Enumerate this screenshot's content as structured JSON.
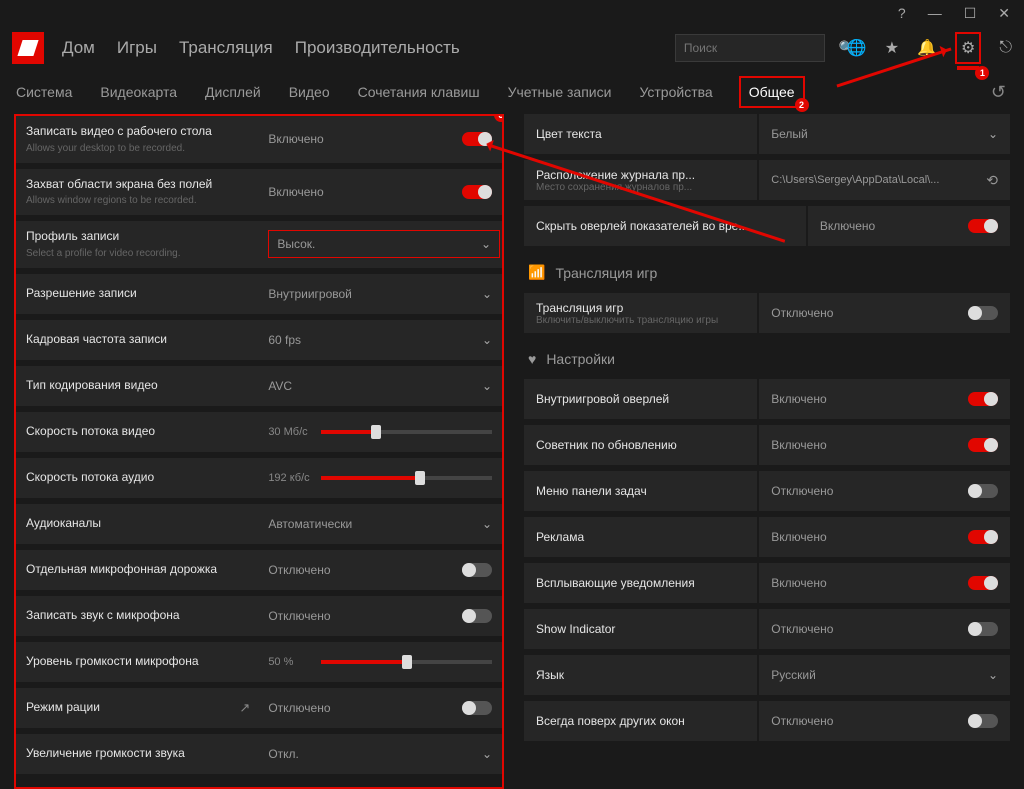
{
  "titlebar": {
    "help": "?",
    "min": "—",
    "max": "☐",
    "close": "✕"
  },
  "nav": {
    "home": "Дом",
    "games": "Игры",
    "stream": "Трансляция",
    "perf": "Производительность"
  },
  "search": {
    "placeholder": "Поиск"
  },
  "tabs": {
    "system": "Система",
    "gpu": "Видеокарта",
    "display": "Дисплей",
    "video": "Видео",
    "hotkeys": "Сочетания клавиш",
    "accounts": "Учетные записи",
    "devices": "Устройства",
    "general": "Общее"
  },
  "badges": {
    "gear": "1",
    "general": "2",
    "panel": "3"
  },
  "left": {
    "rec_desktop": {
      "t": "Записать видео с рабочего стола",
      "d": "Allows your desktop to be recorded.",
      "v": "Включено",
      "on": true
    },
    "region": {
      "t": "Захват области экрана без полей",
      "d": "Allows window regions to be recorded.",
      "v": "Включено",
      "on": true
    },
    "profile": {
      "t": "Профиль записи",
      "d": "Select a profile for video recording.",
      "v": "Высок."
    },
    "resolution": {
      "t": "Разрешение записи",
      "v": "Внутриигровой"
    },
    "fps": {
      "t": "Кадровая частота записи",
      "v": "60 fps"
    },
    "encoding": {
      "t": "Тип кодирования видео",
      "v": "AVC"
    },
    "vbit": {
      "t": "Скорость потока видео",
      "v": "30 Мб/с",
      "pct": 32
    },
    "abit": {
      "t": "Скорость потока аудио",
      "v": "192 кб/с",
      "pct": 58
    },
    "achan": {
      "t": "Аудиоканалы",
      "v": "Автоматически"
    },
    "septrack": {
      "t": "Отдельная микрофонная дорожка",
      "v": "Отключено",
      "on": false
    },
    "recmic": {
      "t": "Записать звук с микрофона",
      "v": "Отключено",
      "on": false
    },
    "micvol": {
      "t": "Уровень громкости микрофона",
      "v": "50 %",
      "pct": 50
    },
    "ptt": {
      "t": "Режим рации",
      "v": "Отключено",
      "on": false
    },
    "boost": {
      "t": "Увеличение громкости звука",
      "v": "Откл."
    }
  },
  "right": {
    "textcolor": {
      "t": "Цвет текста",
      "v": "Белый"
    },
    "logpath": {
      "t": "Расположение журнала пр...",
      "d": "Место сохранения журналов пр...",
      "v": "C:\\Users\\Sergey\\AppData\\Local\\..."
    },
    "hideoverlay": {
      "t": "Скрыть оверлей показателей во вре...",
      "v": "Включено",
      "on": true
    },
    "sec_stream": "Трансляция игр",
    "stream": {
      "t": "Трансляция игр",
      "d": "Включить/выключить трансляцию игры",
      "v": "Отключено",
      "on": false
    },
    "sec_settings": "Настройки",
    "ingame_overlay": {
      "t": "Внутриигровой оверлей",
      "v": "Включено",
      "on": true
    },
    "upgrade": {
      "t": "Советник по обновлению",
      "v": "Включено",
      "on": true
    },
    "taskbar": {
      "t": "Меню панели задач",
      "v": "Отключено",
      "on": false
    },
    "ads": {
      "t": "Реклама",
      "v": "Включено",
      "on": true
    },
    "toasts": {
      "t": "Всплывающие уведомления",
      "v": "Включено",
      "on": true
    },
    "indicator": {
      "t": "Show Indicator",
      "v": "Отключено",
      "on": false
    },
    "lang": {
      "t": "Язык",
      "v": "Русский"
    },
    "ontop": {
      "t": "Всегда поверх других окон",
      "v": "Отключено",
      "on": false
    }
  }
}
